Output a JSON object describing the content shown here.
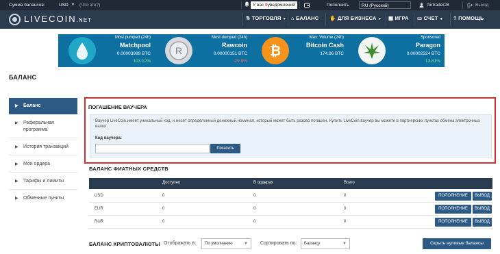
{
  "topbar": {
    "balance_label": "Сумма балансов:",
    "currency": "USD",
    "whats_this": "(Что это?)",
    "notifications_prefix": "У вас",
    "notifications_count": "0",
    "notifications_suffix": "уведомлений",
    "deposit": "Пополнить",
    "language": "RU (Русский)",
    "username": "fortrader28",
    "logout": "Выход"
  },
  "brand": {
    "name": "LIVECOIN",
    "tld": ".NET"
  },
  "nav": {
    "trading": "ТОРГОВЛЯ",
    "balance": "БАЛАНС",
    "business": "ДЛЯ БИЗНЕСА",
    "game": "ИГРА",
    "account": "СЧЕТ",
    "help": "ПОМОЩЬ"
  },
  "promos": [
    {
      "caption": "Most pumped (24h)",
      "name": "Matchpool",
      "price": "0.00003999 BTC",
      "change": "103.12%",
      "direction": "up",
      "icon": "water-drop-icon"
    },
    {
      "caption": "Most dumped (24h)",
      "name": "Rawcoin",
      "price": "0.00000151 BTC",
      "change": "-29.9%",
      "direction": "down",
      "icon": "rawcoin-icon"
    },
    {
      "caption": "Max. Volume (24h)",
      "name": "Bitcoin Cash",
      "price": "174.96 BTC",
      "change": "",
      "direction": "",
      "icon": "bitcoin-icon"
    },
    {
      "caption": "Sponsored",
      "name": "Paragon",
      "price": "0.00002324 BTC",
      "change": "13.81%",
      "direction": "up",
      "icon": "leaf-icon"
    }
  ],
  "page_title": "БАЛАНС",
  "sidebar": [
    {
      "label": "Баланс",
      "active": true
    },
    {
      "label": "Реферальная программа",
      "active": false
    },
    {
      "label": "История транзакций",
      "active": false
    },
    {
      "label": "Мои ордера",
      "active": false
    },
    {
      "label": "Тарифы и лимиты",
      "active": false
    },
    {
      "label": "Обменные пункты",
      "active": false
    }
  ],
  "voucher": {
    "title": "ПОГАШЕНИЕ ВАУЧЕРА",
    "description": "Ваучер LiveCoin имеет уникальный код, и несет определенный денежный номинал, который может быть разово погашен. Купить LiveCoin ваучер вы можете в партнерских пунктах обмена электронных валют.",
    "code_label": "Код ваучера:",
    "code_value": "",
    "redeem_button": "Погасить"
  },
  "fiat": {
    "title": "БАЛАНС ФИАТНЫХ СРЕДСТВ",
    "columns": [
      "",
      "Доступно",
      "В ордерах",
      "Всего"
    ],
    "rows": [
      {
        "currency": "USD",
        "available": "0",
        "in_orders": "0",
        "total": "0"
      },
      {
        "currency": "EUR",
        "available": "0",
        "in_orders": "0",
        "total": "0"
      },
      {
        "currency": "RUR",
        "available": "0",
        "in_orders": "0",
        "total": "0"
      }
    ],
    "deposit_button": "ПОПОЛНЕНИЕ",
    "withdraw_button": "ВЫВОД"
  },
  "crypto": {
    "title": "БАЛАНС КРИПТОВАЛЮТЫ",
    "display_label": "Отображать в:",
    "display_value": "По умолчанию",
    "sort_label": "Сортировать по:",
    "sort_value": "Балансу",
    "hide_zero_button": "Скрыть нулевые балансы"
  },
  "colors": {
    "topbar": "#1f2a36",
    "navbar": "#2a3b4f",
    "accent": "#2d5a85",
    "promo": "#0e6fa1",
    "highlight": "#d32f2f",
    "positive": "#8cf08c",
    "negative": "#ff6b6b"
  }
}
